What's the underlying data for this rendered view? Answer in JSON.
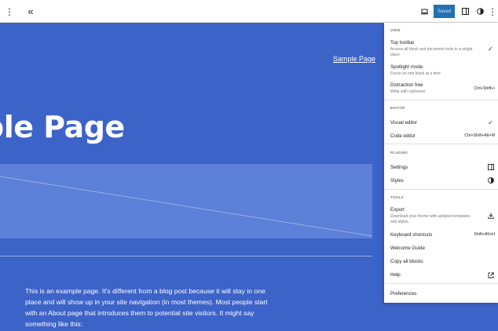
{
  "toolbar": {
    "options_icon": "⋮",
    "collapse_icon": "«",
    "save_label": "Saved",
    "more_icon": "⋮"
  },
  "canvas": {
    "nav_link": "Sample Page",
    "big_title": "ple Page",
    "paragraph": "This is an example page. It's different from a blog post because it will stay in one place and will show up in your site navigation (in most themes). Most people start with an About page that introduces them to potential site visitors. It might say something like this:"
  },
  "menu": {
    "view": {
      "title": "VIEW",
      "top_toolbar": {
        "label": "Top toolbar",
        "desc": "Access all block and document tools in a single place",
        "check": "✓"
      },
      "spotlight": {
        "label": "Spotlight mode",
        "desc": "Focus on one block at a time"
      },
      "distraction": {
        "label": "Distraction free",
        "desc": "Write with calmness",
        "shortcut": "Ctrl+Shift+\\"
      }
    },
    "editor": {
      "title": "EDITOR",
      "visual": {
        "label": "Visual editor",
        "check": "✓"
      },
      "code": {
        "label": "Code editor",
        "shortcut": "Ctrl+Shift+Alt+M"
      }
    },
    "plugins": {
      "title": "PLUGINS",
      "settings": {
        "label": "Settings",
        "icon": "sidebar-icon"
      },
      "styles": {
        "label": "Styles",
        "icon": "half-circle-icon"
      }
    },
    "tools": {
      "title": "TOOLS",
      "export": {
        "label": "Export",
        "desc": "Download your theme with updated templates and styles.",
        "icon": "download-icon"
      },
      "keyboard": {
        "label": "Keyboard shortcuts",
        "shortcut": "Shift+Alt+H"
      },
      "welcome": {
        "label": "Welcome Guide"
      },
      "copy": {
        "label": "Copy all blocks"
      },
      "help": {
        "label": "Help",
        "icon": "external-link-icon"
      }
    },
    "preferences": {
      "label": "Preferences"
    }
  },
  "colors": {
    "canvas_bg": "#3c63c8",
    "image_block": "#5d80d8",
    "save_button": "#2271b1"
  }
}
